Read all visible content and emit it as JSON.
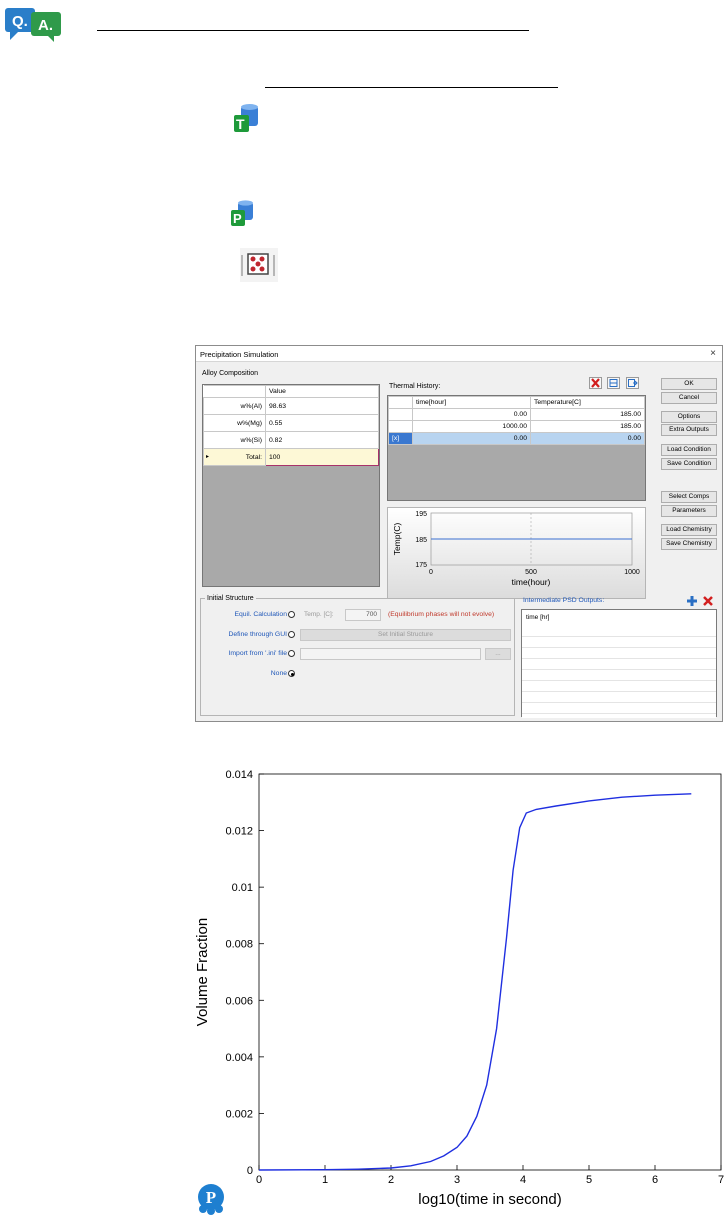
{
  "dialog": {
    "title": "Precipitation Simulation",
    "close_glyph": "×",
    "alloy_composition": {
      "label": "Alloy Composition",
      "column_header": "Value",
      "rows": [
        {
          "name": "w%(Al)",
          "value": "98.63"
        },
        {
          "name": "w%(Mg)",
          "value": "0.55"
        },
        {
          "name": "w%(Si)",
          "value": "0.82"
        },
        {
          "name": "Total:",
          "value": "100"
        }
      ]
    },
    "thermal_history": {
      "label": "Thermal History:",
      "headers": [
        "time[hour]",
        "Temperature[C]"
      ],
      "rows": [
        {
          "marker": "",
          "time": "0.00",
          "temp": "185.00"
        },
        {
          "marker": "",
          "time": "1000.00",
          "temp": "185.00"
        },
        {
          "marker": "[x]",
          "time": "0.00",
          "temp": "0.00"
        }
      ]
    },
    "mini_plot": {
      "ylabel": "Temp(C)",
      "xlabel": "time(hour)",
      "yticks": [
        "195",
        "185",
        "175"
      ],
      "xticks": [
        "0",
        "500",
        "1000"
      ]
    },
    "buttons": {
      "ok": "OK",
      "cancel": "Cancel",
      "options": "Options",
      "extra_outputs": "Extra Outputs",
      "load_condition": "Load Condition",
      "save_condition": "Save Condition",
      "select_comps": "Select Comps",
      "parameters": "Parameters",
      "load_chemistry": "Load Chemistry",
      "save_chemistry": "Save Chemistry"
    },
    "initial_structure": {
      "label": "Initial Structure",
      "equil_label": "Equil. Calculation",
      "temp_label": "Temp. [C]:",
      "temp_value": "700",
      "equil_note": "(Equilibrium phases will not evolve)",
      "gui_label": "Define through GUI",
      "set_initial_button": "Set Initial Structure",
      "import_label": "Import from '.ini' file",
      "browse_button": "...",
      "none_label": "None"
    },
    "psd_outputs": {
      "label": "Intermediate PSD Outputs:",
      "column": "time [hr]"
    }
  },
  "chart_data": {
    "type": "line",
    "title": "",
    "xlabel": "log10(time in second)",
    "ylabel": "Volume Fraction",
    "xlim": [
      0,
      7
    ],
    "ylim": [
      0,
      0.014
    ],
    "xticks": [
      "0",
      "1",
      "2",
      "3",
      "4",
      "5",
      "6",
      "7"
    ],
    "yticks": [
      "0",
      "0.002",
      "0.004",
      "0.006",
      "0.008",
      "0.01",
      "0.012",
      "0.014"
    ],
    "grid": false,
    "series": [
      {
        "color": "#1f2fe0",
        "x": [
          0,
          1.0,
          1.5,
          2.0,
          2.3,
          2.6,
          2.8,
          3.0,
          3.15,
          3.3,
          3.45,
          3.6,
          3.75,
          3.85,
          3.95,
          4.05,
          4.2,
          4.5,
          5.0,
          5.5,
          6.0,
          6.55
        ],
        "y": [
          0,
          1e-05,
          3e-05,
          7e-05,
          0.00015,
          0.0003,
          0.0005,
          0.0008,
          0.0012,
          0.0019,
          0.003,
          0.005,
          0.0082,
          0.0106,
          0.0121,
          0.01262,
          0.01275,
          0.01287,
          0.01305,
          0.01318,
          0.01325,
          0.0133
        ]
      }
    ]
  },
  "colors": {
    "chart_line": "#1f2fe0",
    "dialog_link": "#1f57b8",
    "warning_text": "#c0392b",
    "selected_row": "#b8d4f0",
    "total_row": "#fdf8d6"
  }
}
